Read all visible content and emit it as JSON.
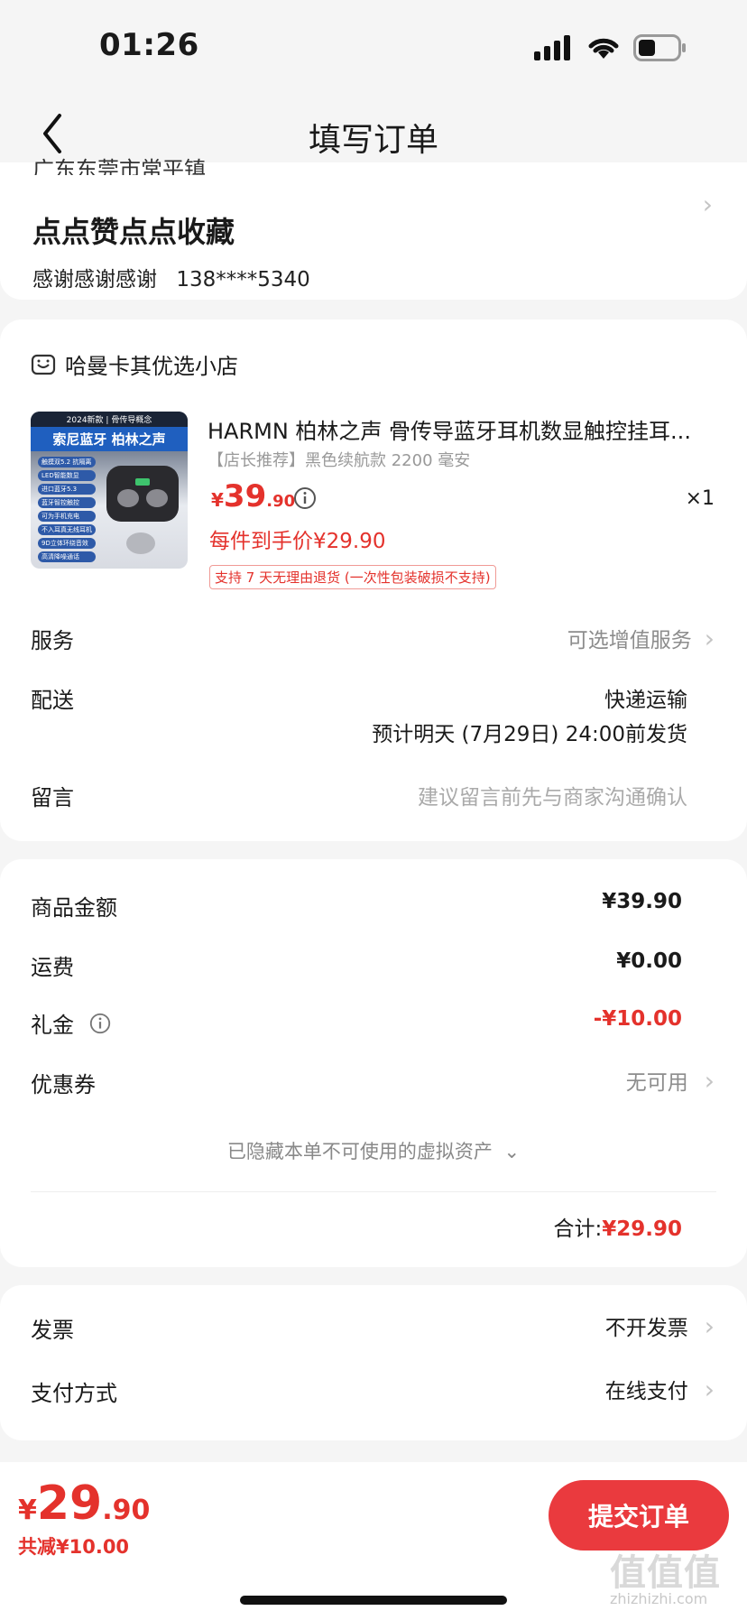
{
  "status": {
    "time": "01:26"
  },
  "nav": {
    "title": "填写订单"
  },
  "address": {
    "partial_line": "广东东莞市常平镇",
    "title": "点点赞点点收藏",
    "contact": "感谢感谢感谢",
    "phone": "138****5340"
  },
  "store": {
    "name": "哈曼卡其优选小店"
  },
  "product": {
    "title": "HARMN 柏林之声 骨传导蓝牙耳机数显触控挂耳...",
    "spec": "【店长推荐】黑色续航款 2200 毫安",
    "price_symbol": "¥",
    "price_int": "39",
    "price_dec": ".90",
    "quantity": "×1",
    "per_item_price": "每件到手价¥29.90",
    "return_policy": "支持 7 天无理由退货 (一次性包装破损不支持)",
    "thumb_banner_top": "2024新款 | 骨传导概念",
    "thumb_banner_main": "索尼蓝牙 柏林之声",
    "thumb_features": [
      "触摸双5.2 抗隔离",
      "LED智能数显",
      "进口蓝牙5.3",
      "蓝牙智控触控",
      "可为手机充电",
      "不入耳真无线耳机",
      "9D立体环绕音效",
      "高清降噪通话"
    ]
  },
  "order_options": {
    "service_label": "服务",
    "service_value": "可选增值服务",
    "delivery_label": "配送",
    "delivery_value": "快递运输",
    "delivery_eta": "预计明天 (7月29日) 24:00前发货",
    "note_label": "留言",
    "note_placeholder": "建议留言前先与商家沟通确认"
  },
  "summary": {
    "goods_label": "商品金额",
    "goods_value": "¥39.90",
    "shipping_label": "运费",
    "shipping_value": "¥0.00",
    "gift_label": "礼金",
    "gift_value": "-¥10.00",
    "coupon_label": "优惠券",
    "coupon_value": "无可用",
    "hidden_assets": "已隐藏本单不可使用的虚拟资产",
    "total_label": "合计:",
    "total_value": "¥29.90"
  },
  "payment": {
    "invoice_label": "发票",
    "invoice_value": "不开发票",
    "method_label": "支付方式",
    "method_value": "在线支付"
  },
  "bottom": {
    "price_symbol": "¥",
    "price_int": "29",
    "price_dec": ".90",
    "discount": "共减¥10.00",
    "submit_label": "提交订单"
  },
  "watermark": {
    "main": "值值值",
    "sub": "zhizhizhi.com"
  },
  "colors": {
    "accent_red": "#e4322c",
    "button_red": "#ea3a3e"
  }
}
